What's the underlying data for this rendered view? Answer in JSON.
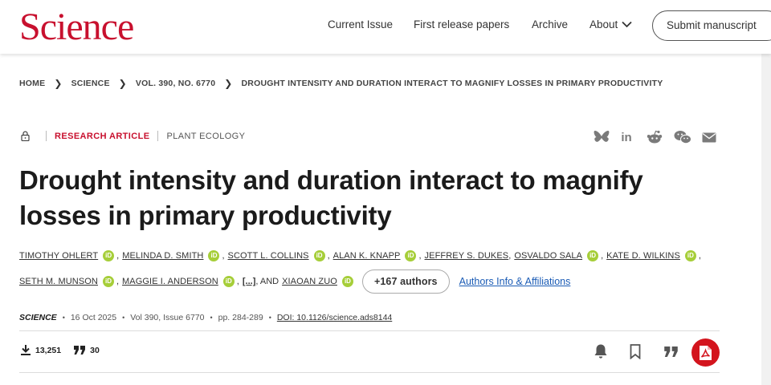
{
  "header": {
    "logo": "Science",
    "nav": [
      "Current Issue",
      "First release papers",
      "Archive",
      "About"
    ],
    "submit_label": "Submit manuscript"
  },
  "breadcrumb": [
    "HOME",
    "SCIENCE",
    "VOL. 390, NO. 6770",
    "DROUGHT INTENSITY AND DURATION INTERACT TO MAGNIFY LOSSES IN PRIMARY PRODUCTIVITY"
  ],
  "article": {
    "type": "RESEARCH ARTICLE",
    "subject": "PLANT ECOLOGY",
    "title": "Drought intensity and duration interact to magnify losses in primary productivity",
    "authors_row1": [
      "TIMOTHY OHLERT",
      "MELINDA D. SMITH",
      "SCOTT L. COLLINS",
      "ALAN K. KNAPP",
      "JEFFREY S. DUKES",
      "OSVALDO SALA",
      "KATE D. WILKINS"
    ],
    "authors_row2": [
      "SETH M. MUNSON",
      "MAGGIE I. ANDERSON"
    ],
    "ellipsis": "[...]",
    "and_text": ", AND",
    "last_author": "XIAOAN ZUO",
    "more_authors": "+167 authors",
    "affiliations_link": "Authors Info & Affiliations",
    "orcid_label": "iD"
  },
  "citation": {
    "journal": "SCIENCE",
    "date": "16 Oct 2025",
    "volume_issue": "Vol 390, Issue 6770",
    "pages": "pp. 284-289",
    "doi": "DOI: 10.1126/science.ads8144"
  },
  "metrics": {
    "downloads": "13,251",
    "citations": "30"
  },
  "share_icons": [
    "bluesky-icon",
    "linkedin-icon",
    "reddit-icon",
    "wechat-icon",
    "email-icon"
  ],
  "colors": {
    "brand": "#c8102e",
    "orcid": "#a6ce39",
    "pdf": "#d3141d",
    "link": "#1a5bb5"
  }
}
